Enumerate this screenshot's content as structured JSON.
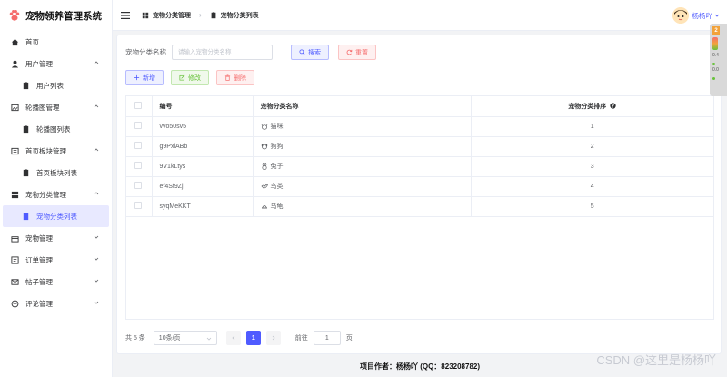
{
  "app": {
    "title": "宠物领养管理系统"
  },
  "sidebar": {
    "items": [
      {
        "label": "首页",
        "icon": "home-icon"
      },
      {
        "label": "用户管理",
        "icon": "user-icon"
      },
      {
        "label": "用户列表",
        "icon": "doc-icon"
      },
      {
        "label": "轮播图管理",
        "icon": "image-icon"
      },
      {
        "label": "轮播图列表",
        "icon": "doc-icon"
      },
      {
        "label": "首页板块管理",
        "icon": "panel-icon"
      },
      {
        "label": "首页板块列表",
        "icon": "doc-icon"
      },
      {
        "label": "宠物分类管理",
        "icon": "grid-icon"
      },
      {
        "label": "宠物分类列表",
        "icon": "doc-icon"
      },
      {
        "label": "宠物管理",
        "icon": "gift-icon"
      },
      {
        "label": "订单管理",
        "icon": "order-icon"
      },
      {
        "label": "帖子管理",
        "icon": "mail-icon"
      },
      {
        "label": "评论管理",
        "icon": "chat-icon"
      }
    ]
  },
  "header": {
    "breadcrumb": [
      "宠物分类管理",
      "宠物分类列表"
    ],
    "user_name": "杨杨吖"
  },
  "search": {
    "label": "宠物分类名称",
    "placeholder": "请输入宠物分类名称",
    "search_button": "搜索",
    "reset_button": "重置"
  },
  "toolbar": {
    "add": "新增",
    "edit": "修改",
    "delete": "删除"
  },
  "table": {
    "columns": [
      "编号",
      "宠物分类名称",
      "宠物分类排序"
    ],
    "rows": [
      {
        "code": "vvo50sv5",
        "name": "猫咪",
        "icon": "cat-icon",
        "sort": "1"
      },
      {
        "code": "g9PxiABb",
        "name": "狗狗",
        "icon": "dog-icon",
        "sort": "2"
      },
      {
        "code": "9V1kLtys",
        "name": "兔子",
        "icon": "rabbit-icon",
        "sort": "3"
      },
      {
        "code": "ef4Sf9Zj",
        "name": "鸟类",
        "icon": "bird-icon",
        "sort": "4"
      },
      {
        "code": "syqMeKKT",
        "name": "乌龟",
        "icon": "turtle-icon",
        "sort": "5"
      }
    ]
  },
  "pagination": {
    "total": "共 5 条",
    "page_size": "10条/页",
    "current_page": "1",
    "goto_label": "前往",
    "goto_value": "1",
    "page_unit": "页"
  },
  "footer": {
    "text": "项目作者：杨杨吖 (QQ：823208782)"
  },
  "watermark": "CSDN @这里是杨杨吖",
  "side_widget": {
    "badge": "2",
    "value1": "0.4",
    "value2": "0.0"
  },
  "colors": {
    "accent": "#4f5bff",
    "danger": "#f56c6c",
    "success": "#67c23a"
  }
}
